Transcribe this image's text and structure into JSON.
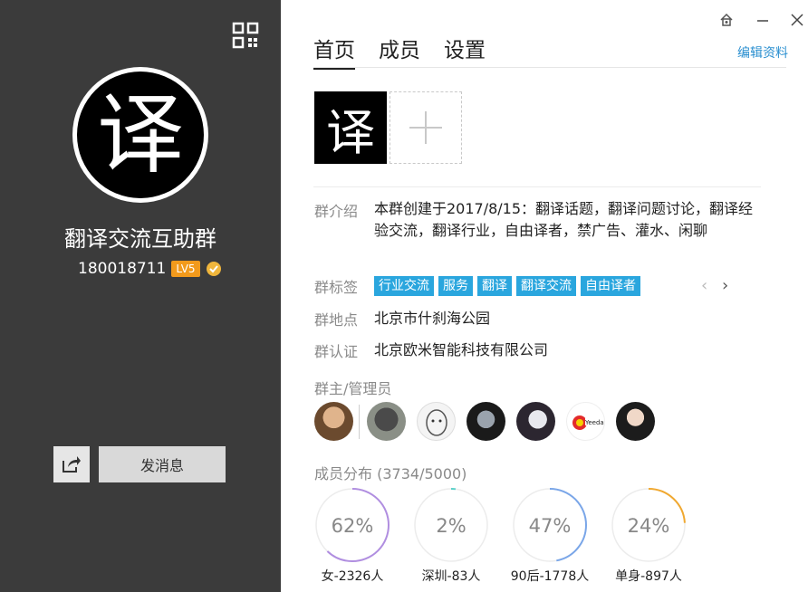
{
  "window": {
    "controls": [
      "skin-icon",
      "minimize-icon",
      "close-icon"
    ]
  },
  "left": {
    "avatar_char": "译",
    "group_name": "翻译交流互助群",
    "group_id": "180018711",
    "level": "LV5",
    "send_message_label": "发消息"
  },
  "tabs": [
    {
      "label": "首页",
      "active": true
    },
    {
      "label": "成员",
      "active": false
    },
    {
      "label": "设置",
      "active": false
    }
  ],
  "edit_profile_label": "编辑资料",
  "photo_char": "译",
  "info": {
    "intro_label": "群介绍",
    "intro_text": "本群创建于2017/8/15：翻译话题，翻译问题讨论，翻译经验交流，翻译行业，自由译者，禁广告、灌水、闲聊",
    "tags_label": "群标签",
    "tags": [
      "行业交流",
      "服务",
      "翻译",
      "翻译交流",
      "自由译者"
    ],
    "location_label": "群地点",
    "location": "北京市什刹海公园",
    "verify_label": "群认证",
    "verify": "北京欧米智能科技有限公司"
  },
  "admins_label": "群主/管理员",
  "admins_count": 7,
  "distribution": {
    "title": "成员分布",
    "count": "(3734/5000)",
    "items": [
      {
        "percent": "62%",
        "value": 0.62,
        "label": "女-2326人",
        "color": "#b08ee0"
      },
      {
        "percent": "2%",
        "value": 0.02,
        "label": "深圳-83人",
        "color": "#5ad0c8"
      },
      {
        "percent": "47%",
        "value": 0.47,
        "label": "90后-1778人",
        "color": "#7aa6e8"
      },
      {
        "percent": "24%",
        "value": 0.24,
        "label": "单身-897人",
        "color": "#f0a830"
      }
    ]
  },
  "colors": {
    "left_bg": "#3b3b3b",
    "accent": "#2aa6de",
    "link": "#2a8fd0",
    "level": "#f29a1c"
  }
}
